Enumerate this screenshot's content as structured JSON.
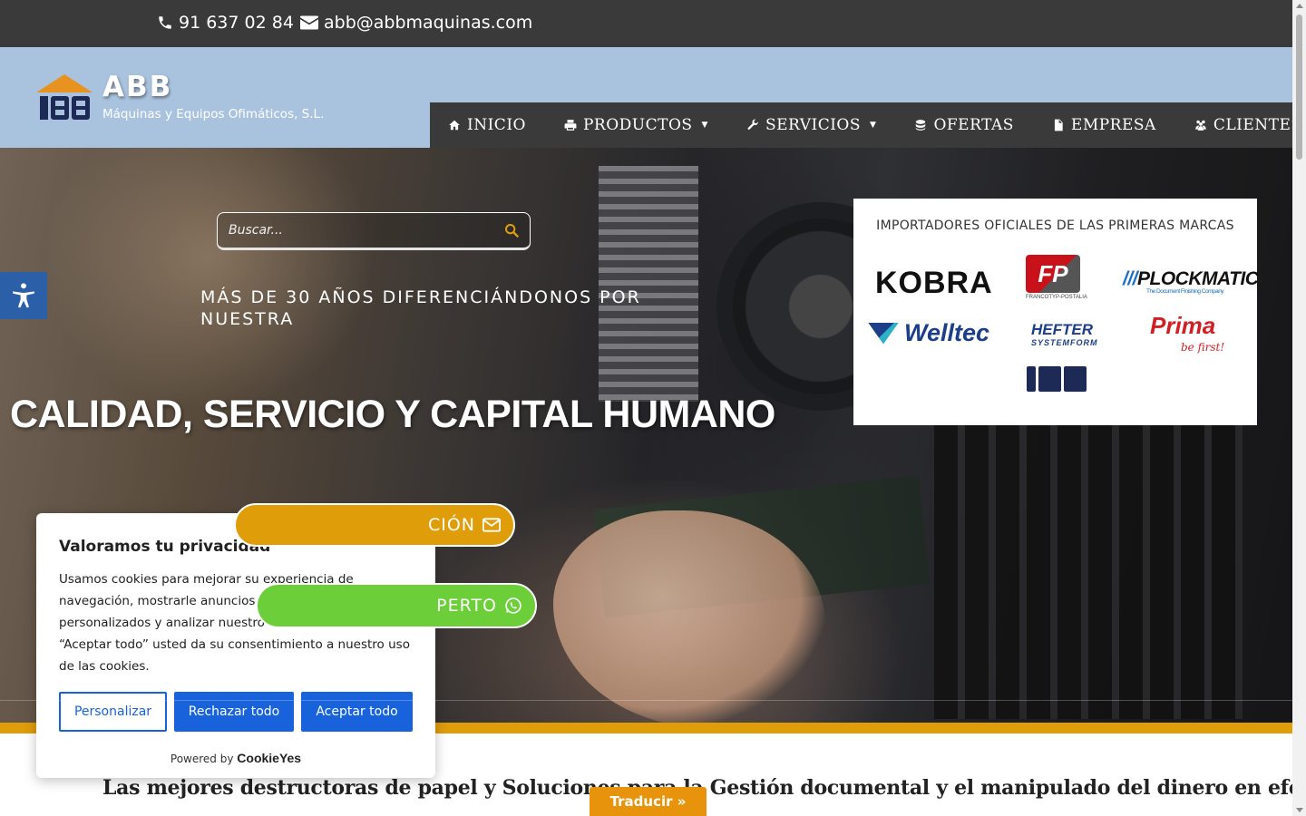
{
  "topbar": {
    "phone": "91 637 02 84",
    "email": "abb@abbmaquinas.com"
  },
  "logo": {
    "brand": "ABB",
    "tagline": "Máquinas y Equipos Ofimáticos, S.L."
  },
  "nav": {
    "items": [
      {
        "label": "INICIO",
        "icon": "home-icon"
      },
      {
        "label": "PRODUCTOS",
        "icon": "printer-icon",
        "has_dropdown": true
      },
      {
        "label": "SERVICIOS",
        "icon": "wrench-icon",
        "has_dropdown": true
      },
      {
        "label": "OFERTAS",
        "icon": "coins-icon"
      },
      {
        "label": "EMPRESA",
        "icon": "document-icon"
      },
      {
        "label": "CLIENTES",
        "icon": "users-icon"
      }
    ]
  },
  "search": {
    "placeholder": "Buscar..."
  },
  "hero": {
    "subtitle": "MÁS DE 30 AÑOS DIFERENCIÁNDONOS POR NUESTRA",
    "title": "CALIDAD, SERVICIO Y CAPITAL HUMANO",
    "btn_info_label": "CIÓN",
    "btn_expert_label": "PERTO"
  },
  "brands": {
    "title": "IMPORTADORES OFICIALES DE LAS PRIMERAS MARCAS",
    "items": {
      "kobra": "KOBRA",
      "fp": "FP",
      "fp_sub": "FRANCOTYP-POSTALIA",
      "plockmatic": "PLOCKMATIC",
      "plockmatic_sub": "The Document Finishing Company",
      "welltec": "Welltec",
      "hefter": "HEFTER",
      "hefter_sub": "SYSTEMFORM",
      "prima": "Prima",
      "prima_sub": "be first!"
    }
  },
  "tagline_main": "Las mejores destructoras de papel y Soluciones para la Gestión documental y el manipulado del dinero en efectivo.",
  "translate": {
    "label": "Traducir »"
  },
  "cookie": {
    "title": "Valoramos tu privacidad",
    "body": "Usamos cookies para mejorar su experiencia de navegación, mostrarle anuncios o contenidos personalizados y analizar nuestro tráfico. Al hacer clic en “Aceptar todo” usted da su consentimiento a nuestro uso de las cookies.",
    "btn_customize": "Personalizar",
    "btn_reject": "Rechazar todo",
    "btn_accept": "Aceptar todo",
    "powered_by": "Powered by",
    "powered_brand": "CookieYes"
  },
  "colors": {
    "accent_orange": "#e09d0a",
    "whatsapp_green": "#6ccf3a",
    "header_blue": "#a9c3df",
    "dark_bar": "#3a3a3a",
    "cookie_blue": "#1863dc"
  }
}
